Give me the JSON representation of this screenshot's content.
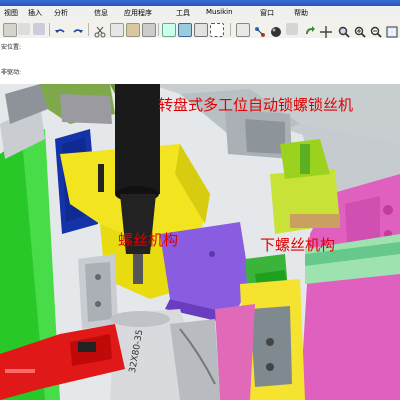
{
  "menu": {
    "items": [
      "视图",
      "插入",
      "分析",
      "信息",
      "应用程序",
      "工具",
      "Musikin",
      "窗口",
      "帮助"
    ]
  },
  "infopanel": {
    "line1": "安位置:",
    "line2": "非驱动:"
  },
  "annotations": {
    "title": "转盘式多工位自动锁螺锁丝机",
    "screw_mechanism": "螺丝机构",
    "lower_screw_mechanism": "下螺丝机构",
    "part_label": "32X80-35"
  },
  "colors": {
    "annotation": "#e00000",
    "titlebar": "#2a55b8"
  }
}
